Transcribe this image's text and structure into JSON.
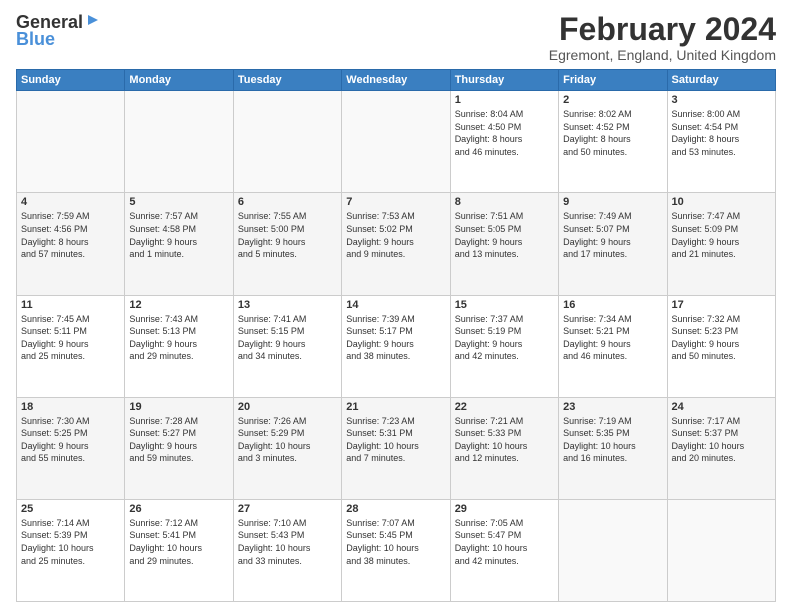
{
  "logo": {
    "general": "General",
    "blue": "Blue"
  },
  "header": {
    "title": "February 2024",
    "subtitle": "Egremont, England, United Kingdom"
  },
  "columns": [
    "Sunday",
    "Monday",
    "Tuesday",
    "Wednesday",
    "Thursday",
    "Friday",
    "Saturday"
  ],
  "weeks": [
    [
      {
        "day": "",
        "info": ""
      },
      {
        "day": "",
        "info": ""
      },
      {
        "day": "",
        "info": ""
      },
      {
        "day": "",
        "info": ""
      },
      {
        "day": "1",
        "info": "Sunrise: 8:04 AM\nSunset: 4:50 PM\nDaylight: 8 hours\nand 46 minutes."
      },
      {
        "day": "2",
        "info": "Sunrise: 8:02 AM\nSunset: 4:52 PM\nDaylight: 8 hours\nand 50 minutes."
      },
      {
        "day": "3",
        "info": "Sunrise: 8:00 AM\nSunset: 4:54 PM\nDaylight: 8 hours\nand 53 minutes."
      }
    ],
    [
      {
        "day": "4",
        "info": "Sunrise: 7:59 AM\nSunset: 4:56 PM\nDaylight: 8 hours\nand 57 minutes."
      },
      {
        "day": "5",
        "info": "Sunrise: 7:57 AM\nSunset: 4:58 PM\nDaylight: 9 hours\nand 1 minute."
      },
      {
        "day": "6",
        "info": "Sunrise: 7:55 AM\nSunset: 5:00 PM\nDaylight: 9 hours\nand 5 minutes."
      },
      {
        "day": "7",
        "info": "Sunrise: 7:53 AM\nSunset: 5:02 PM\nDaylight: 9 hours\nand 9 minutes."
      },
      {
        "day": "8",
        "info": "Sunrise: 7:51 AM\nSunset: 5:05 PM\nDaylight: 9 hours\nand 13 minutes."
      },
      {
        "day": "9",
        "info": "Sunrise: 7:49 AM\nSunset: 5:07 PM\nDaylight: 9 hours\nand 17 minutes."
      },
      {
        "day": "10",
        "info": "Sunrise: 7:47 AM\nSunset: 5:09 PM\nDaylight: 9 hours\nand 21 minutes."
      }
    ],
    [
      {
        "day": "11",
        "info": "Sunrise: 7:45 AM\nSunset: 5:11 PM\nDaylight: 9 hours\nand 25 minutes."
      },
      {
        "day": "12",
        "info": "Sunrise: 7:43 AM\nSunset: 5:13 PM\nDaylight: 9 hours\nand 29 minutes."
      },
      {
        "day": "13",
        "info": "Sunrise: 7:41 AM\nSunset: 5:15 PM\nDaylight: 9 hours\nand 34 minutes."
      },
      {
        "day": "14",
        "info": "Sunrise: 7:39 AM\nSunset: 5:17 PM\nDaylight: 9 hours\nand 38 minutes."
      },
      {
        "day": "15",
        "info": "Sunrise: 7:37 AM\nSunset: 5:19 PM\nDaylight: 9 hours\nand 42 minutes."
      },
      {
        "day": "16",
        "info": "Sunrise: 7:34 AM\nSunset: 5:21 PM\nDaylight: 9 hours\nand 46 minutes."
      },
      {
        "day": "17",
        "info": "Sunrise: 7:32 AM\nSunset: 5:23 PM\nDaylight: 9 hours\nand 50 minutes."
      }
    ],
    [
      {
        "day": "18",
        "info": "Sunrise: 7:30 AM\nSunset: 5:25 PM\nDaylight: 9 hours\nand 55 minutes."
      },
      {
        "day": "19",
        "info": "Sunrise: 7:28 AM\nSunset: 5:27 PM\nDaylight: 9 hours\nand 59 minutes."
      },
      {
        "day": "20",
        "info": "Sunrise: 7:26 AM\nSunset: 5:29 PM\nDaylight: 10 hours\nand 3 minutes."
      },
      {
        "day": "21",
        "info": "Sunrise: 7:23 AM\nSunset: 5:31 PM\nDaylight: 10 hours\nand 7 minutes."
      },
      {
        "day": "22",
        "info": "Sunrise: 7:21 AM\nSunset: 5:33 PM\nDaylight: 10 hours\nand 12 minutes."
      },
      {
        "day": "23",
        "info": "Sunrise: 7:19 AM\nSunset: 5:35 PM\nDaylight: 10 hours\nand 16 minutes."
      },
      {
        "day": "24",
        "info": "Sunrise: 7:17 AM\nSunset: 5:37 PM\nDaylight: 10 hours\nand 20 minutes."
      }
    ],
    [
      {
        "day": "25",
        "info": "Sunrise: 7:14 AM\nSunset: 5:39 PM\nDaylight: 10 hours\nand 25 minutes."
      },
      {
        "day": "26",
        "info": "Sunrise: 7:12 AM\nSunset: 5:41 PM\nDaylight: 10 hours\nand 29 minutes."
      },
      {
        "day": "27",
        "info": "Sunrise: 7:10 AM\nSunset: 5:43 PM\nDaylight: 10 hours\nand 33 minutes."
      },
      {
        "day": "28",
        "info": "Sunrise: 7:07 AM\nSunset: 5:45 PM\nDaylight: 10 hours\nand 38 minutes."
      },
      {
        "day": "29",
        "info": "Sunrise: 7:05 AM\nSunset: 5:47 PM\nDaylight: 10 hours\nand 42 minutes."
      },
      {
        "day": "",
        "info": ""
      },
      {
        "day": "",
        "info": ""
      }
    ]
  ]
}
